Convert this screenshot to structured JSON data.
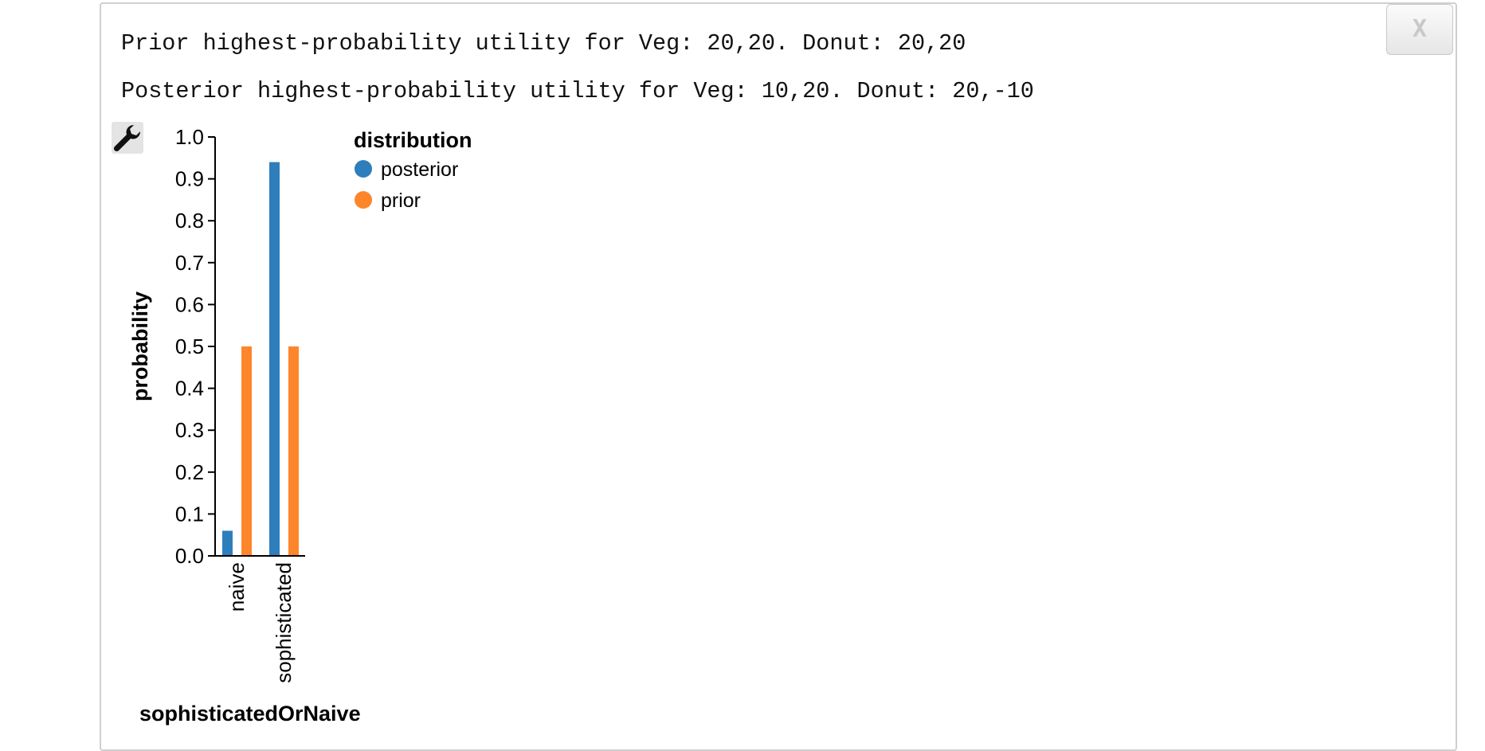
{
  "output": {
    "lines": [
      "Prior highest-probability utility for Veg: 20,20. Donut: 20,20",
      "Posterior highest-probability utility for Veg: 10,20. Donut: 20,-10"
    ]
  },
  "close_label": "X",
  "icons": {
    "close": "close-icon",
    "options": "wrench-icon"
  },
  "colors": {
    "posterior": "#2f7ebc",
    "prior": "#fd862b"
  },
  "chart_data": {
    "type": "bar",
    "categories": [
      "naive",
      "sophisticated"
    ],
    "series": [
      {
        "name": "posterior",
        "values": [
          0.06,
          0.94
        ]
      },
      {
        "name": "prior",
        "values": [
          0.5,
          0.5
        ]
      }
    ],
    "xlabel": "sophisticatedOrNaive",
    "ylabel": "probability",
    "ylim": [
      0,
      1
    ],
    "yticks": [
      "0.0",
      "0.1",
      "0.2",
      "0.3",
      "0.4",
      "0.5",
      "0.6",
      "0.7",
      "0.8",
      "0.9",
      "1.0"
    ],
    "legend": {
      "title": "distribution",
      "position": "top-right",
      "entries": [
        "posterior",
        "prior"
      ]
    },
    "grid": false
  }
}
